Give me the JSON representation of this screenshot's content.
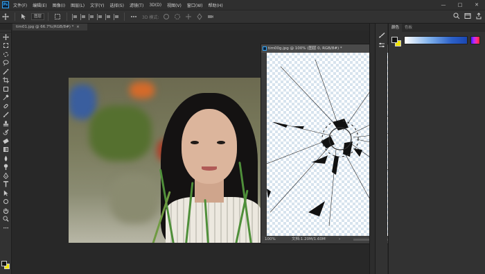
{
  "app": {
    "logo": "Ps"
  },
  "menu": [
    "文件(F)",
    "编辑(E)",
    "图像(I)",
    "图层(L)",
    "文字(Y)",
    "选择(S)",
    "滤镜(T)",
    "3D(D)",
    "视图(V)",
    "窗口(W)",
    "帮助(H)"
  ],
  "window_controls": {
    "minimize": "—",
    "maximize": "□",
    "close": "✕"
  },
  "options_bar": {
    "auto_select_value": "图层",
    "mode_3d_label": "3D 模式:"
  },
  "document_tab": {
    "title": "tim01.jpg @ 66.7%(RGB/8#) *",
    "close": "×"
  },
  "floating_window": {
    "title": "tim00g.jpg @ 100% (图层 0, RGB/8#) *",
    "zoom": "100%",
    "doc_info": "文档:1.20M/1.60M",
    "status_arrow": "›"
  },
  "color_panel": {
    "tabs": [
      "颜色",
      "色板"
    ],
    "foreground": "#111111",
    "background": "#f0e300"
  },
  "colors": {
    "accent": "#31a8ff",
    "bg": "#282828",
    "panel": "#323232"
  }
}
